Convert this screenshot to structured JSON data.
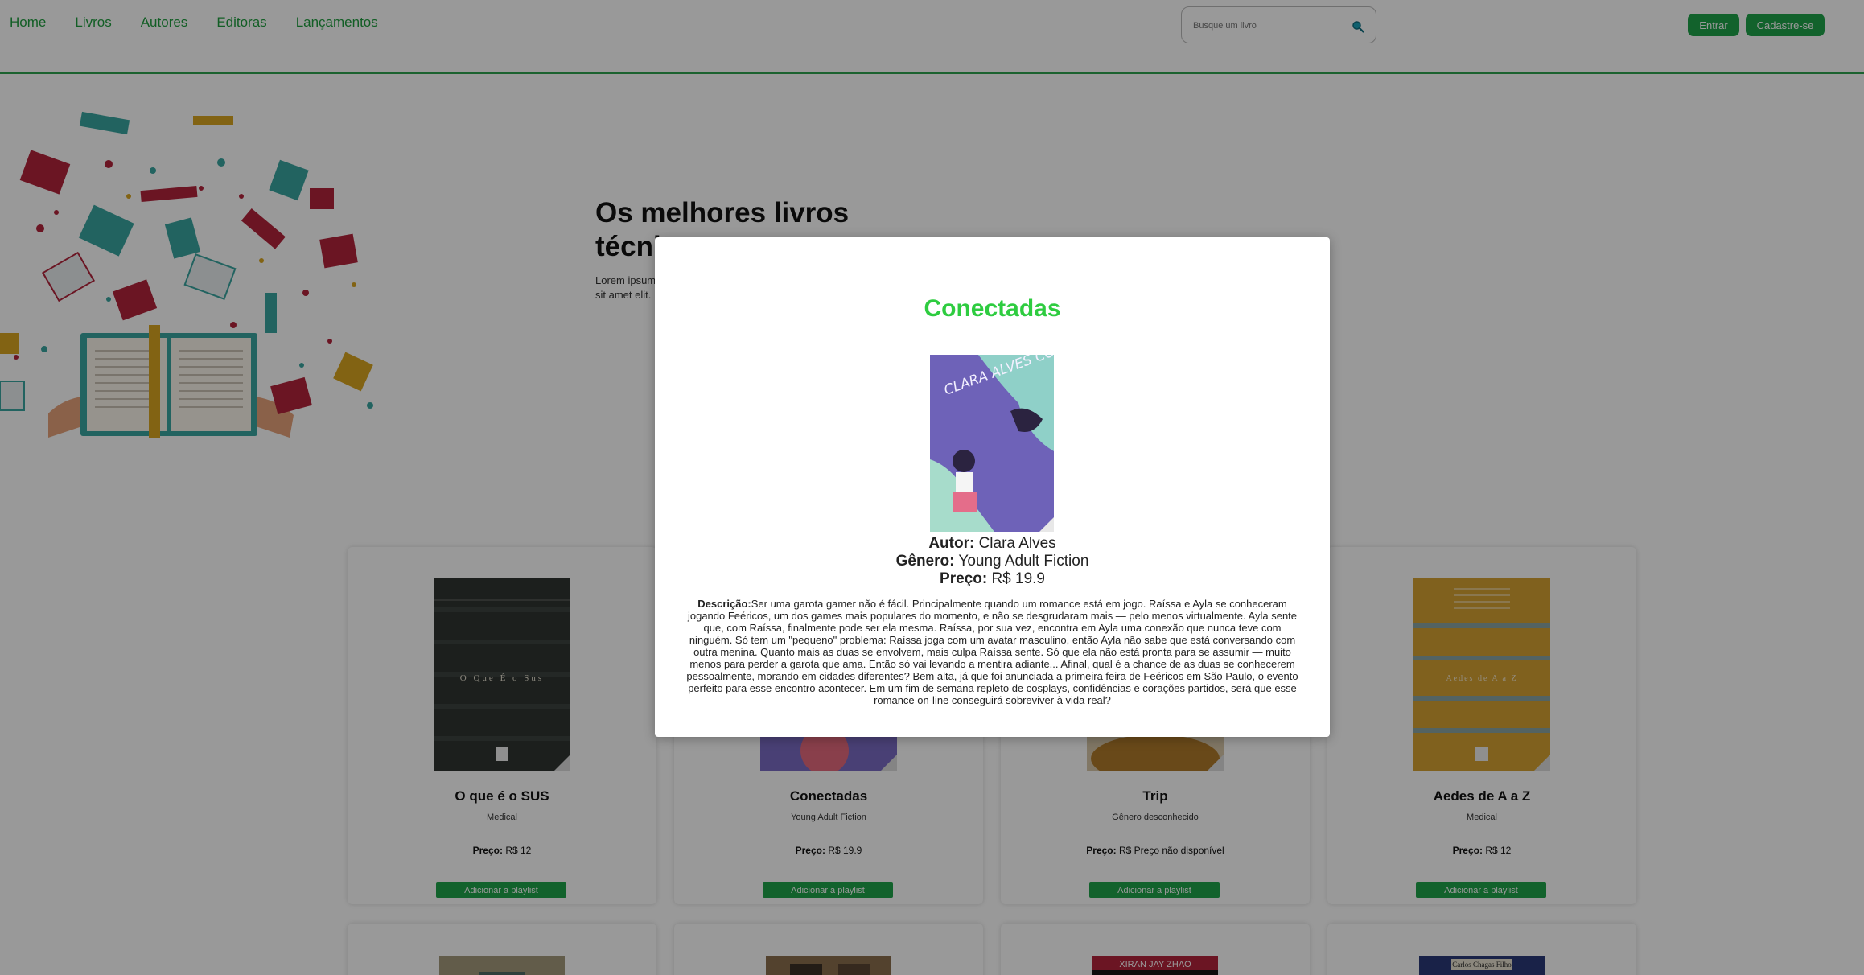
{
  "nav": {
    "links": [
      "Home",
      "Livros",
      "Autores",
      "Editoras",
      "Lançamentos"
    ],
    "search_placeholder": "Busque um livro",
    "login_label": "Entrar",
    "signup_label": "Cadastre-se"
  },
  "hero": {
    "title": "Os melhores livros técnicos",
    "text": "Lorem ipsum dolor sit amet elit."
  },
  "books": [
    {
      "title": "O que é o SUS",
      "genre": "Medical",
      "price_label": "Preço:",
      "price": "R$ 12",
      "button": "Adicionar a playlist",
      "cover_text": "O Que É o Sus"
    },
    {
      "title": "Conectadas",
      "genre": "Young Adult Fiction",
      "price_label": "Preço:",
      "price": "R$ 19.9",
      "button": "Adicionar a playlist"
    },
    {
      "title": "Trip",
      "genre": "Gênero desconhecido",
      "price_label": "Preço:",
      "price": "R$ Preço não disponível",
      "button": "Adicionar a playlist"
    },
    {
      "title": "Aedes de A a Z",
      "genre": "Medical",
      "price_label": "Preço:",
      "price": "R$ 12",
      "button": "Adicionar a playlist",
      "cover_text": "Aedes de A a Z"
    }
  ],
  "second_row_covers": [
    "",
    "",
    "XIRAN JAY ZHAO",
    "Carlos Chagas Filho"
  ],
  "modal": {
    "title": "Conectadas",
    "cover_text": "CLARA ALVES CONECTADAS",
    "author_label": "Autor:",
    "author": "Clara Alves",
    "genre_label": "Gênero:",
    "genre": "Young Adult Fiction",
    "price_label": "Preço:",
    "price": "R$ 19.9",
    "description_label": "Descrição:",
    "description": "Ser uma garota gamer não é fácil. Principalmente quando um romance está em jogo. Raíssa e Ayla se conheceram jogando Feéricos, um dos games mais populares do momento, e não se desgrudaram mais — pelo menos virtualmente. Ayla sente que, com Raíssa, finalmente pode ser ela mesma. Raíssa, por sua vez, encontra em Ayla uma conexão que nunca teve com ninguém. Só tem um \"pequeno\" problema: Raíssa joga com um avatar masculino, então Ayla não sabe que está conversando com outra menina. Quanto mais as duas se envolvem, mais culpa Raíssa sente. Só que ela não está pronta para se assumir — muito menos para perder a garota que ama. Então só vai levando a mentira adiante... Afinal, qual é a chance de as duas se conhecerem pessoalmente, morando em cidades diferentes? Bem alta, já que foi anunciada a primeira feira de Feéricos em São Paulo, o evento perfeito para esse encontro acontecer. Em um fim de semana repleto de cosplays, confidências e corações partidos, será que esse romance on-line conseguirá sobreviver à vida real?"
  }
}
